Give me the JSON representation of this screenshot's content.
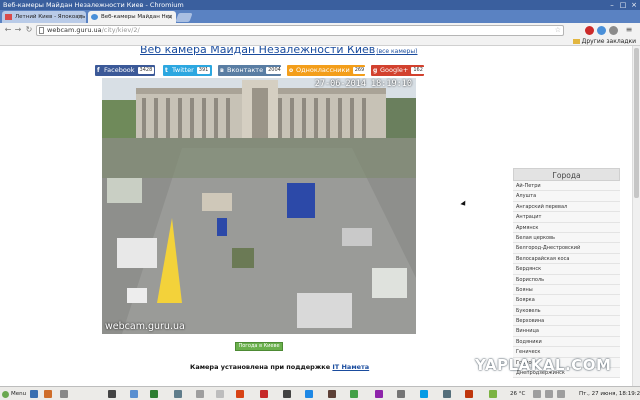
{
  "window": {
    "title": "Веб-камеры Майдан Незалежности Киев - Chromium",
    "minimize": "–",
    "maximize": "□",
    "close": "×"
  },
  "tabs": [
    {
      "label": "Летний Киев - Япокоаль"
    },
    {
      "label": "Веб-камеры Майдан Нез"
    }
  ],
  "toolbar": {
    "back": "←",
    "forward": "→",
    "reload": "↻",
    "url_host": "webcam.guru.ua",
    "url_path": "/city/kiev/2/"
  },
  "bookmarks": {
    "other_label": "Другие закладки"
  },
  "page": {
    "heading": "Веб камера Майдан Незалежности Киев",
    "all_cameras_link": "(все камеры)",
    "share": [
      {
        "label": "Facebook",
        "count": "3428",
        "icon": "f",
        "color": "#3b5998"
      },
      {
        "label": "Twitter",
        "count": "391",
        "icon": "t",
        "color": "#2ca7e0"
      },
      {
        "label": "Вконтакте",
        "count": "2004",
        "icon": "в",
        "color": "#597da3"
      },
      {
        "label": "Одноклассники",
        "count": "269",
        "icon": "о",
        "color": "#f39e1a"
      },
      {
        "label": "Google+",
        "count": "162",
        "icon": "g",
        "color": "#d2412e"
      }
    ],
    "cam_timestamp": "27-06-2014 18:19:10",
    "cam_watermark": "webcam.guru.ua",
    "weather_button": "Погода в Киеве",
    "support_text": "Камера установлена при поддержке ",
    "support_link": "IT Намета"
  },
  "cities": {
    "title": "Города",
    "items": [
      "Ай-Петри",
      "Алушта",
      "Ангарский перевал",
      "Антрацит",
      "Армянск",
      "Белая церковь",
      "Белгород-Днестровский",
      "Велосарайская коса",
      "Бердянск",
      "Борисполь",
      "Бояны",
      "Боярка",
      "Буковель",
      "Верховина",
      "Винница",
      "Водяники",
      "Геническ",
      "Горлов",
      "Днепродзержинск"
    ]
  },
  "overlay_watermark": "YAPLAKAL.COM",
  "taskbar": {
    "menu_label": "Menu",
    "temperature": "26 °C",
    "clock": "Пт., 27 июня, 18:19:29"
  }
}
